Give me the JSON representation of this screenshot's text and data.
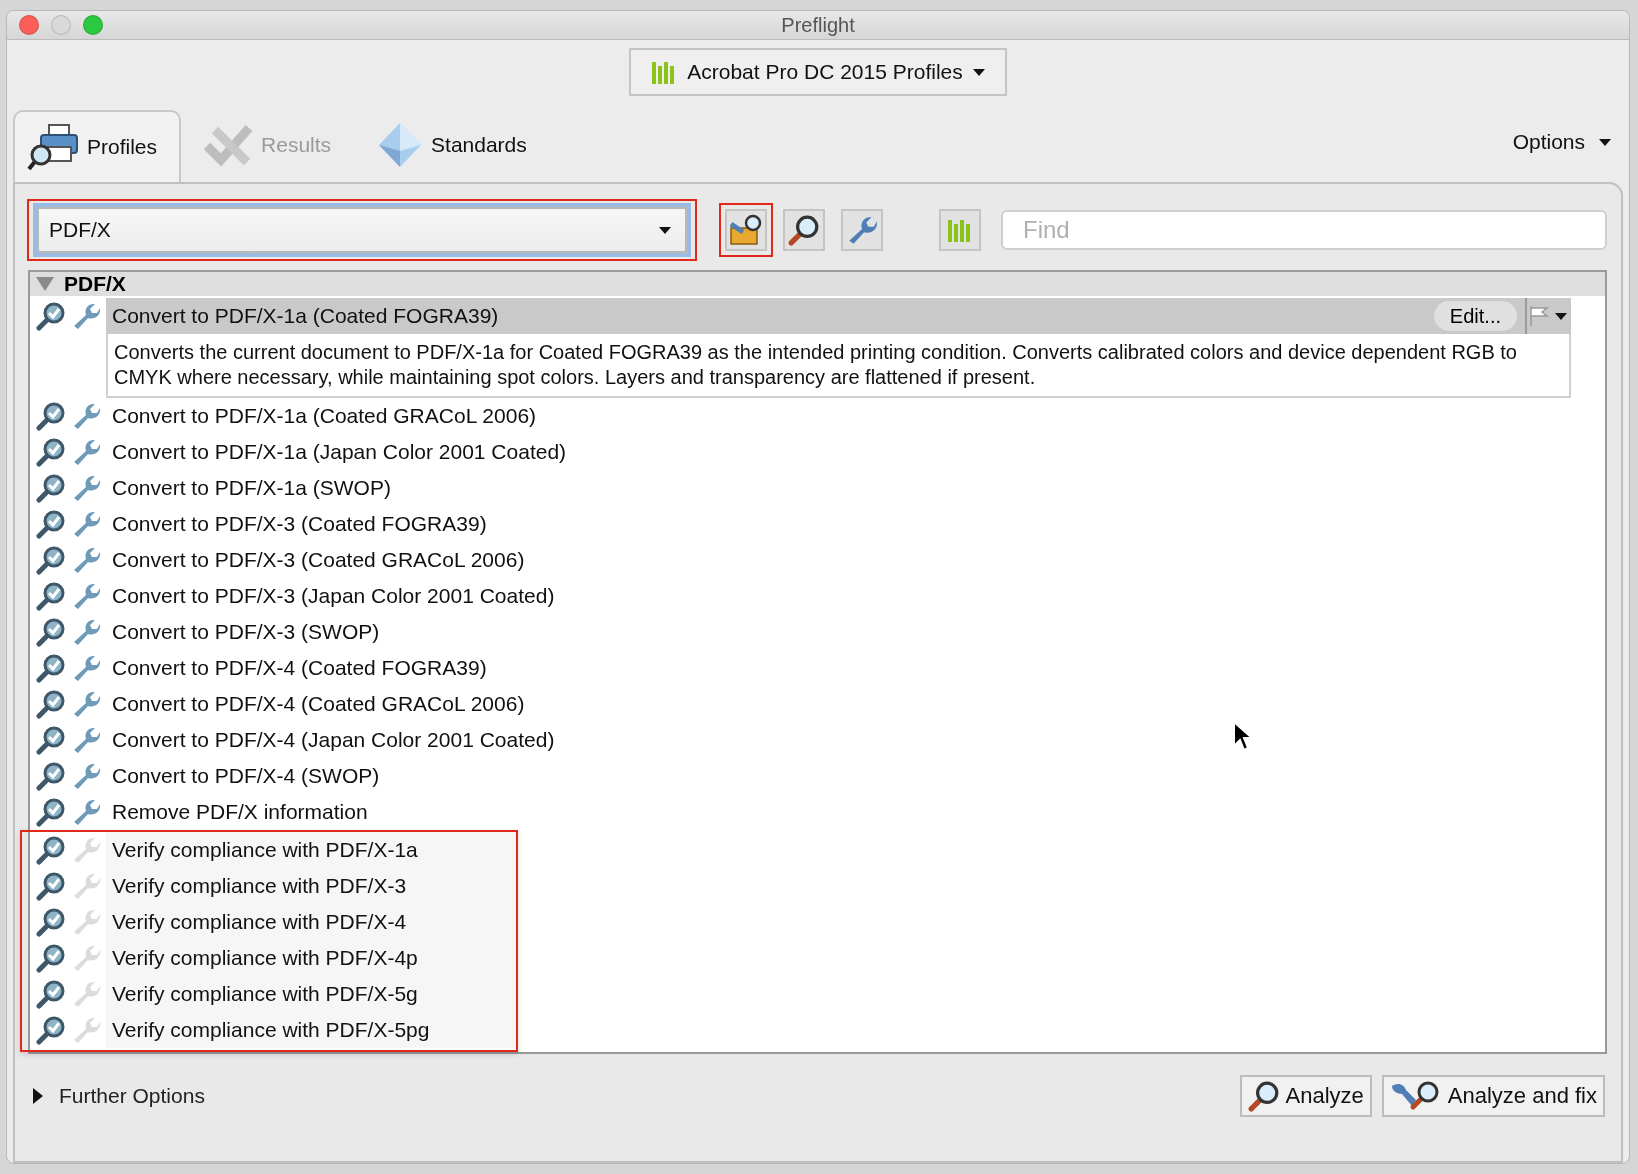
{
  "window": {
    "title": "Preflight"
  },
  "library_menu": {
    "label": "Acrobat Pro DC 2015 Profiles"
  },
  "tabs": [
    {
      "label": "Profiles",
      "kind": "profiles",
      "selected": true,
      "disabled": false
    },
    {
      "label": "Results",
      "kind": "results",
      "selected": false,
      "disabled": true
    },
    {
      "label": "Standards",
      "kind": "standards",
      "selected": false,
      "disabled": false
    }
  ],
  "options_menu": {
    "label": "Options"
  },
  "category_select": {
    "value": "PDF/X",
    "highlighted": true
  },
  "toolbar_buttons": [
    {
      "kind": "profiles",
      "highlighted": true
    },
    {
      "kind": "checks",
      "highlighted": false
    },
    {
      "kind": "fixups",
      "highlighted": false
    }
  ],
  "search": {
    "placeholder": "Find"
  },
  "group": {
    "label": "PDF/X",
    "expanded": true,
    "profiles": [
      {
        "label": "Convert to PDF/X-1a (Coated FOGRA39)",
        "fixable": true,
        "selected": true,
        "highlighted": false,
        "action": "Edit...",
        "description": "Converts the current document to PDF/X-1a for Coated FOGRA39 as the intended printing condition. Converts calibrated colors and device dependent RGB to CMYK where necessary, while maintaining spot colors. Layers and transparency are flattened if present."
      },
      {
        "label": "Convert to PDF/X-1a (Coated GRACoL 2006)",
        "fixable": true,
        "selected": false,
        "highlighted": false
      },
      {
        "label": "Convert to PDF/X-1a (Japan Color 2001 Coated)",
        "fixable": true,
        "selected": false,
        "highlighted": false
      },
      {
        "label": "Convert to PDF/X-1a (SWOP)",
        "fixable": true,
        "selected": false,
        "highlighted": false
      },
      {
        "label": "Convert to PDF/X-3 (Coated FOGRA39)",
        "fixable": true,
        "selected": false,
        "highlighted": false
      },
      {
        "label": "Convert to PDF/X-3 (Coated GRACoL 2006)",
        "fixable": true,
        "selected": false,
        "highlighted": false
      },
      {
        "label": "Convert to PDF/X-3 (Japan Color 2001 Coated)",
        "fixable": true,
        "selected": false,
        "highlighted": false
      },
      {
        "label": "Convert to PDF/X-3 (SWOP)",
        "fixable": true,
        "selected": false,
        "highlighted": false
      },
      {
        "label": "Convert to PDF/X-4 (Coated FOGRA39)",
        "fixable": true,
        "selected": false,
        "highlighted": false
      },
      {
        "label": "Convert to PDF/X-4 (Coated GRACoL 2006)",
        "fixable": true,
        "selected": false,
        "highlighted": false
      },
      {
        "label": "Convert to PDF/X-4 (Japan Color 2001 Coated)",
        "fixable": true,
        "selected": false,
        "highlighted": false
      },
      {
        "label": "Convert to PDF/X-4 (SWOP)",
        "fixable": true,
        "selected": false,
        "highlighted": false
      },
      {
        "label": "Remove PDF/X information",
        "fixable": true,
        "selected": false,
        "highlighted": false
      },
      {
        "label": "Verify compliance with PDF/X-1a",
        "fixable": false,
        "selected": false,
        "highlighted": true
      },
      {
        "label": "Verify compliance with PDF/X-3",
        "fixable": false,
        "selected": false,
        "highlighted": true
      },
      {
        "label": "Verify compliance with PDF/X-4",
        "fixable": false,
        "selected": false,
        "highlighted": true
      },
      {
        "label": "Verify compliance with PDF/X-4p",
        "fixable": false,
        "selected": false,
        "highlighted": true
      },
      {
        "label": "Verify compliance with PDF/X-5g",
        "fixable": false,
        "selected": false,
        "highlighted": true
      },
      {
        "label": "Verify compliance with PDF/X-5pg",
        "fixable": false,
        "selected": false,
        "highlighted": true
      }
    ]
  },
  "further_options": {
    "label": "Further Options",
    "expanded": false
  },
  "buttons": [
    {
      "label": "Analyze",
      "kind": "analyze"
    },
    {
      "label": "Analyze and fix",
      "kind": "fix"
    }
  ]
}
